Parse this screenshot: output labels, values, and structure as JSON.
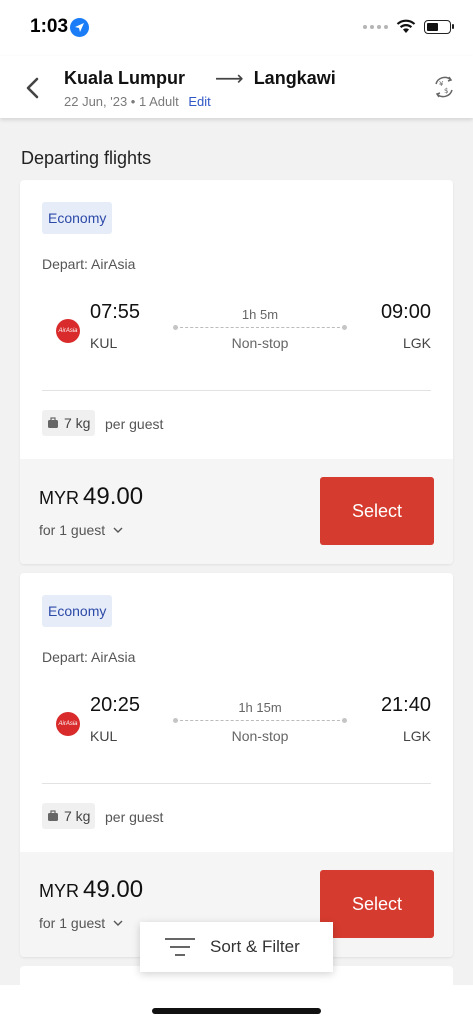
{
  "status_bar": {
    "time": "1:03"
  },
  "header": {
    "origin": "Kuala Lumpur",
    "destination": "Langkawi",
    "details": "22 Jun, '23 • 1 Adult",
    "edit_label": "Edit",
    "icons": {
      "back": "chevron-left-icon",
      "currency": "currency-exchange-icon"
    }
  },
  "section_title": "Departing flights",
  "flights": [
    {
      "fare_class": "Economy",
      "depart_label": "Depart: AirAsia",
      "airline_logo_text": "AirAsia",
      "dep_time": "07:55",
      "dep_code": "KUL",
      "arr_time": "09:00",
      "arr_code": "LGK",
      "duration": "1h 5m",
      "stops": "Non-stop",
      "baggage": "7 kg",
      "baggage_suffix": "per guest",
      "currency": "MYR",
      "price": "49.00",
      "guest_label": "for 1 guest",
      "select_label": "Select"
    },
    {
      "fare_class": "Economy",
      "depart_label": "Depart: AirAsia",
      "airline_logo_text": "AirAsia",
      "dep_time": "20:25",
      "dep_code": "KUL",
      "arr_time": "21:40",
      "arr_code": "LGK",
      "duration": "1h 15m",
      "stops": "Non-stop",
      "baggage": "7 kg",
      "baggage_suffix": "per guest",
      "currency": "MYR",
      "price": "49.00",
      "guest_label": "for 1 guest",
      "select_label": "Select"
    }
  ],
  "sort_filter_label": "Sort & Filter",
  "colors": {
    "accent": "#d63b2f",
    "link": "#2f58c5",
    "badge_bg": "#e6ecf8"
  }
}
